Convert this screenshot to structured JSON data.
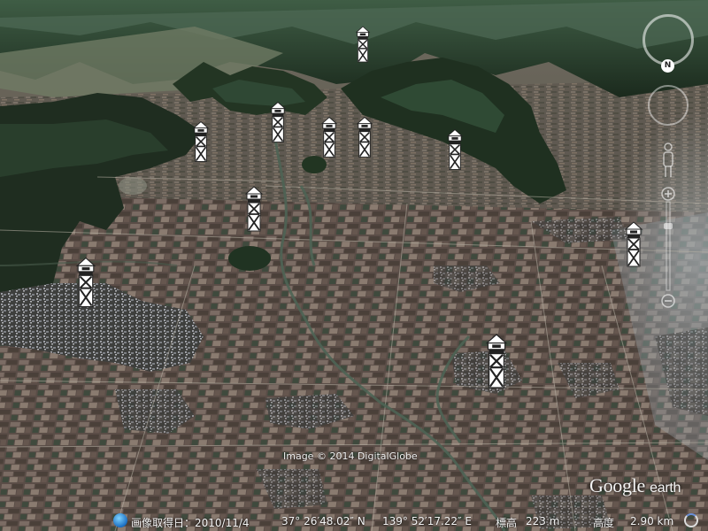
{
  "map": {
    "attribution": "Image © 2014 DigitalGlobe",
    "logo_text": "Google",
    "logo_suffix": "earth",
    "compass_letter": "N"
  },
  "status_bar": {
    "acquired": "画像取得日：2010/11/4",
    "latitude": "37° 26′48.02″ N",
    "longitude": "139° 52′17.22″ E",
    "elevation_label": "標高",
    "elevation_value": "223 m",
    "altitude_label": "高度",
    "altitude_value": "2.90 km"
  },
  "markers": [
    {
      "name": "tower-marker",
      "icon": "watchtower-icon"
    },
    {
      "name": "tower-marker",
      "icon": "watchtower-icon"
    },
    {
      "name": "tower-marker",
      "icon": "watchtower-icon"
    },
    {
      "name": "tower-marker",
      "icon": "watchtower-icon"
    },
    {
      "name": "tower-marker",
      "icon": "watchtower-icon"
    },
    {
      "name": "tower-marker",
      "icon": "watchtower-icon"
    },
    {
      "name": "tower-marker",
      "icon": "watchtower-icon"
    },
    {
      "name": "tower-marker",
      "icon": "watchtower-icon"
    },
    {
      "name": "tower-marker",
      "icon": "watchtower-icon"
    },
    {
      "name": "tower-marker",
      "icon": "watchtower-icon"
    }
  ],
  "colors": {
    "sky_haze": "#7c8c7a",
    "mountain_dark": "#1f2e20",
    "mountain_mid": "#304a33",
    "field_base": "#5a4e47",
    "field_light": "#8a7c72",
    "river": "#4f6255",
    "town": "#8d8f95"
  }
}
